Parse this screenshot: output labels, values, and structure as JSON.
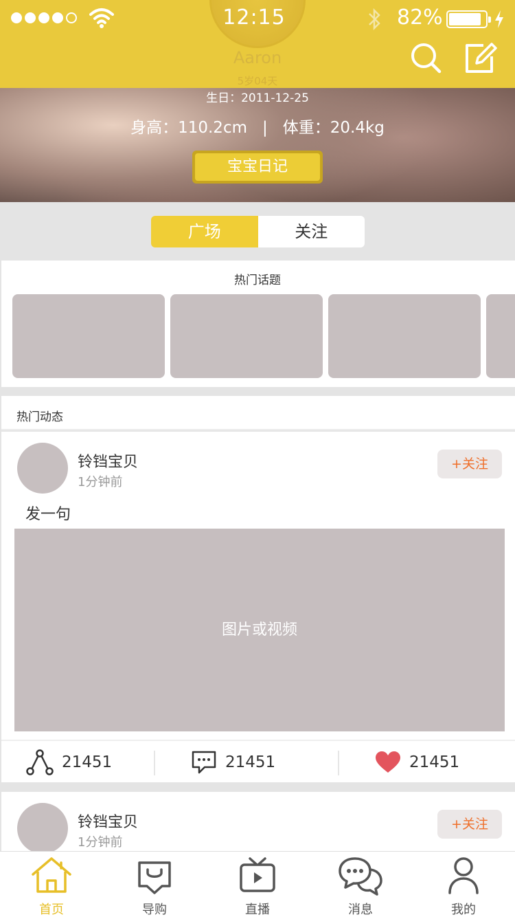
{
  "status_bar": {
    "time": "12:15",
    "battery_percent": "82%",
    "battery_level": 0.82,
    "signal_bars_filled": 4,
    "signal_bars_total": 5
  },
  "profile": {
    "name": "Aaron",
    "age": "5岁04天",
    "birthday": "生日：2011-12-25",
    "height": "身高：110.2cm",
    "separator": "|",
    "weight": "体重：20.4kg",
    "diary_button": "宝宝日记"
  },
  "header_icons": [
    "search-icon",
    "edit-icon"
  ],
  "segmented_tabs": [
    {
      "label": "广场",
      "active": true
    },
    {
      "label": "关注",
      "active": false
    }
  ],
  "hot_topics": {
    "title": "热门话题"
  },
  "feed": {
    "title": "热门动态",
    "posts": [
      {
        "author": "铃铛宝贝",
        "time": "1分钟前",
        "follow": "+关注",
        "text": "发一句",
        "media_placeholder": "图片或视频",
        "shares": "21451",
        "comments": "21451",
        "likes": "21451"
      },
      {
        "author": "铃铛宝贝",
        "time": "1分钟前",
        "follow": "+关注"
      }
    ]
  },
  "tabbar": [
    {
      "label": "首页",
      "icon": "home-icon",
      "active": true
    },
    {
      "label": "导购",
      "icon": "shopping-bag-icon",
      "active": false
    },
    {
      "label": "直播",
      "icon": "tv-icon",
      "active": false
    },
    {
      "label": "消息",
      "icon": "chat-bubbles-icon",
      "active": false
    },
    {
      "label": "我的",
      "icon": "user-icon",
      "active": false
    }
  ],
  "colors": {
    "accent": "#f0ce36",
    "header": "#e9c93c",
    "follow_text": "#ef6f2a",
    "like": "#e3545d",
    "placeholder": "#c7bfc0"
  }
}
